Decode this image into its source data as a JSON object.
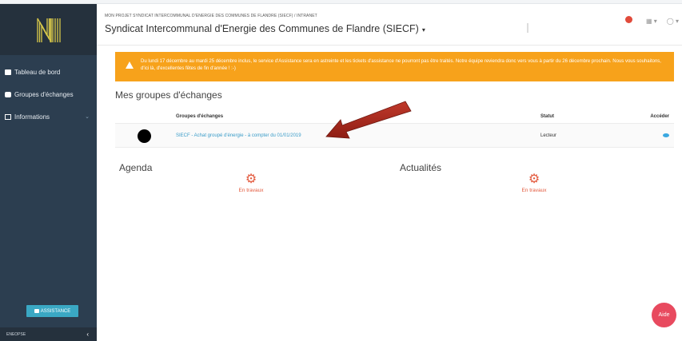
{
  "sidebar": {
    "items": [
      {
        "label": "Tableau de bord",
        "icon": "dashboard-icon"
      },
      {
        "label": "Groupes d'échanges",
        "icon": "chat-icon"
      },
      {
        "label": "Informations",
        "icon": "list-icon"
      }
    ],
    "assist_label": "ASSISTANCE",
    "footer_label": "ENEOPSE"
  },
  "header": {
    "breadcrumb": "MON PROJET SYNDICAT INTERCOMMUNAL D'ENERGIE DES COMMUNES DE FLANDRE (SIECF) / INTRANET",
    "title": "Syndicat Intercommunal d'Energie des Communes de Flandre (SIECF)",
    "icons": [
      "bell-icon",
      "apps-grid-icon",
      "user-icon"
    ]
  },
  "alert": {
    "text": "Du lundi 17 décembre au mardi 25 décembre inclus, le service d'Assistance sera en astreinte et les tickets d'assistance ne pourront pas être traités. Notre équipe reviendra donc vers vous à partir du 26 décembre prochain. Nous vous souhaitons, d'ici là, d'excellentes fêtes de fin d'année ! :-)"
  },
  "groups": {
    "title": "Mes groupes d'échanges",
    "columns": [
      "Groupes d'échanges",
      "Statut",
      "Accéder"
    ],
    "rows": [
      {
        "name": "SIECF - Achat groupé d'énergie - à compter du 01/01/2019",
        "statut": "Lecteur"
      }
    ]
  },
  "agenda": {
    "title": "Agenda",
    "status": "En travaux"
  },
  "actus": {
    "title": "Actualités",
    "status": "En travaux"
  },
  "help_label": "Aide",
  "colors": {
    "sidebar": "#2c3e50",
    "alert": "#f7a21b",
    "link": "#3a9cc8",
    "accent": "#e35a3e",
    "help": "#e84a5f"
  }
}
